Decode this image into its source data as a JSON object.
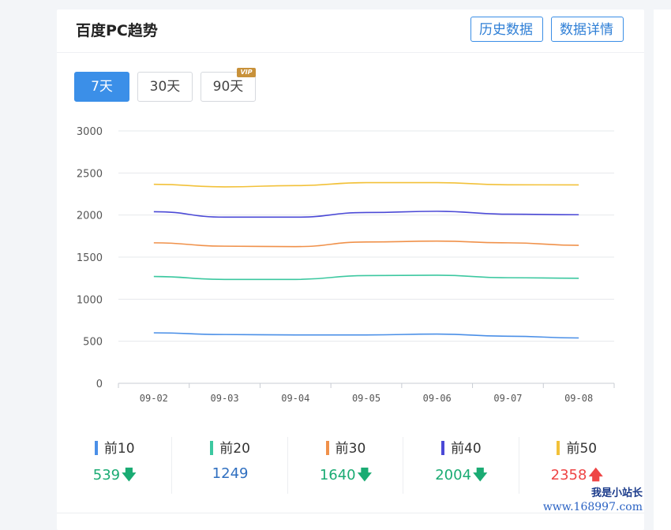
{
  "header": {
    "title": "百度PC趋势",
    "history_btn": "历史数据",
    "detail_btn": "数据详情"
  },
  "ranges": [
    {
      "label": "7天",
      "active": true
    },
    {
      "label": "30天",
      "active": false
    },
    {
      "label": "90天",
      "active": false
    }
  ],
  "vip_badge": "VIP",
  "chart_data": {
    "type": "line",
    "x": [
      "09-02",
      "09-03",
      "09-04",
      "09-05",
      "09-06",
      "09-07",
      "09-08"
    ],
    "ylim": [
      0,
      3000
    ],
    "yticks": [
      "0",
      "500",
      "1000",
      "1500",
      "2000",
      "2500",
      "3000"
    ],
    "grid": true,
    "series": [
      {
        "name": "前10",
        "color": "#4a8fe7",
        "values": [
          600,
          580,
          575,
          575,
          585,
          560,
          539
        ]
      },
      {
        "name": "前20",
        "color": "#3cc8a0",
        "values": [
          1270,
          1235,
          1235,
          1280,
          1285,
          1255,
          1249
        ]
      },
      {
        "name": "前30",
        "color": "#f0914a",
        "values": [
          1670,
          1630,
          1625,
          1680,
          1690,
          1670,
          1640
        ]
      },
      {
        "name": "前40",
        "color": "#4b49d6",
        "values": [
          2040,
          1975,
          1975,
          2030,
          2045,
          2010,
          2004
        ]
      },
      {
        "name": "前50",
        "color": "#f2c139",
        "values": [
          2365,
          2335,
          2350,
          2385,
          2385,
          2360,
          2358
        ]
      }
    ]
  },
  "stats": [
    {
      "label": "前10",
      "color": "#4a8fe7",
      "value": "539",
      "trend": "down",
      "value_color": "#1aab73",
      "arrow": "🡇"
    },
    {
      "label": "前20",
      "color": "#3cc8a0",
      "value": "1249",
      "trend": "flat",
      "value_color": "#2f6fc0",
      "arrow": ""
    },
    {
      "label": "前30",
      "color": "#f0914a",
      "value": "1640",
      "trend": "down",
      "value_color": "#1aab73",
      "arrow": "🡇"
    },
    {
      "label": "前40",
      "color": "#4b49d6",
      "value": "2004",
      "trend": "down",
      "value_color": "#1aab73",
      "arrow": "🡇"
    },
    {
      "label": "前50",
      "color": "#f2c139",
      "value": "2358",
      "trend": "up",
      "value_color": "#ee4545",
      "arrow": "🡅"
    }
  ],
  "watermark": {
    "line1": "我是小站长",
    "line2": "www.168997.com"
  }
}
